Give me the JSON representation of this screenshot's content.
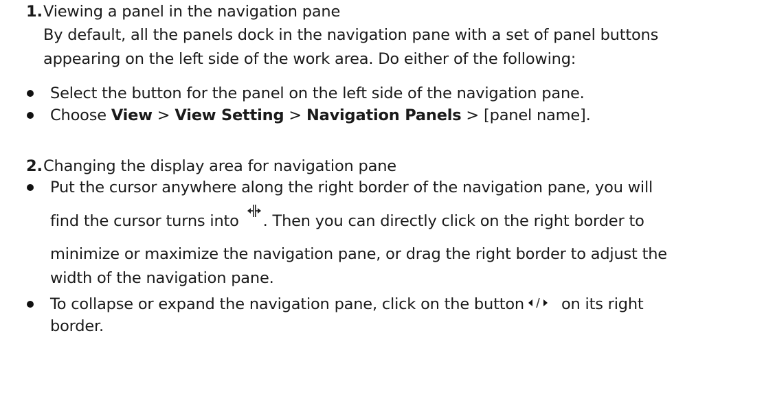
{
  "section1": {
    "number": "1.",
    "heading": "Viewing a panel in the navigation pane",
    "para_line1": "By default, all the panels dock in the navigation pane with a set of panel buttons",
    "para_line2": "appearing on the left side of the work area. Do either of the following:",
    "bullet1": "Select the button for the panel on the left side of the navigation pane.",
    "bullet2": {
      "prefix": "Choose ",
      "view": "View",
      "sep1": " > ",
      "view_setting": "View Setting",
      "sep2": " > ",
      "nav_panels": "Navigation Panels",
      "sep3": " > ",
      "suffix": "[panel name]."
    }
  },
  "section2": {
    "number": "2.",
    "heading": "Changing the display area for navigation pane",
    "bullet1_line1": "Put the cursor anywhere along the right border of the navigation pane, you will",
    "bullet1_line2a": "find the cursor turns into ",
    "bullet1_line2b": ". Then you can directly click on the right border to",
    "bullet1_line3": "minimize or maximize the navigation pane, or drag the right border to adjust the",
    "bullet1_line4": "width of the navigation pane.",
    "bullet2_line1a": "To collapse or expand the navigation pane, click on the button",
    "bullet2_line1b": "on its right",
    "bullet2_line2": "border.",
    "resize_cursor_icon": "resize-cursor-icon",
    "collapse_icon": "triangle-left-icon",
    "expand_icon": "triangle-right-icon"
  }
}
